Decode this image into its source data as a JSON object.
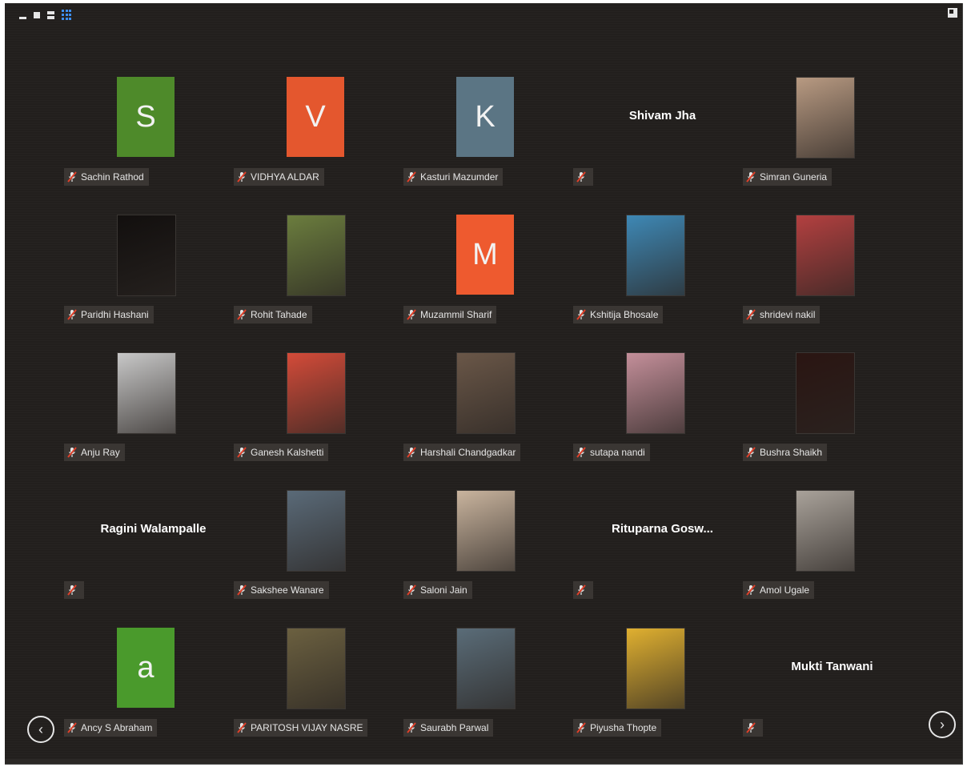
{
  "toolbar": {
    "icons": [
      "minimize-icon",
      "single-view-icon",
      "split-view-icon",
      "gallery-view-icon"
    ],
    "accent": "#3d8ef0"
  },
  "participants": [
    {
      "name": "Sachin Rathod",
      "avatar_letter": "S",
      "avatar_color": "#4e8a2a",
      "type": "letter"
    },
    {
      "name": "VIDHYA ALDAR",
      "avatar_letter": "V",
      "avatar_color": "#e4572e",
      "type": "letter"
    },
    {
      "name": "Kasturi Mazumder",
      "avatar_letter": "K",
      "avatar_color": "#5b7584",
      "type": "letter"
    },
    {
      "name": "",
      "display_name": "Shivam Jha",
      "type": "name"
    },
    {
      "name": "Simran Guneria",
      "type": "photo",
      "photo": "photo-woman-selfie",
      "tone": "#b89a82"
    },
    {
      "name": "Paridhi Hashani",
      "type": "photo",
      "photo": "photo-dark",
      "tone": "#120f0e"
    },
    {
      "name": "Rohit Tahade",
      "type": "photo",
      "photo": "photo-man-garden",
      "tone": "#6b7d3e"
    },
    {
      "name": "Muzammil Sharif",
      "avatar_letter": "M",
      "avatar_color": "#ee5a2f",
      "type": "letter"
    },
    {
      "name": "Kshitija Bhosale",
      "type": "photo",
      "photo": "photo-mountain-lake",
      "tone": "#3e88b5"
    },
    {
      "name": "shridevi nakil",
      "type": "photo",
      "photo": "photo-woman-red",
      "tone": "#b34040"
    },
    {
      "name": "Anju Ray",
      "type": "photo",
      "photo": "photo-man-suit",
      "tone": "#c8c8c8"
    },
    {
      "name": "Ganesh Kalshetti",
      "type": "photo",
      "photo": "photo-man-red-shirt",
      "tone": "#d44b39"
    },
    {
      "name": "Harshali Chandgadkar",
      "type": "photo",
      "photo": "photo-woman-portrait",
      "tone": "#6a5748"
    },
    {
      "name": "sutapa nandi",
      "type": "photo",
      "photo": "photo-woman-pink",
      "tone": "#c48f9a"
    },
    {
      "name": "Bushra Shaikh",
      "type": "photo",
      "photo": "photo-dark-red",
      "tone": "#2a1512"
    },
    {
      "name": "",
      "display_name": "Ragini Walampalle",
      "type": "name"
    },
    {
      "name": "Sakshee Wanare",
      "type": "photo",
      "photo": "photo-woman-selfie-2",
      "tone": "#5a6a78"
    },
    {
      "name": "Saloni Jain",
      "type": "photo",
      "photo": "photo-woman-light",
      "tone": "#c9b49e"
    },
    {
      "name": "",
      "display_name": "Rituparna  Gosw...",
      "type": "name"
    },
    {
      "name": "Amol Ugale",
      "type": "photo",
      "photo": "photo-man-standing",
      "tone": "#a9a29a"
    },
    {
      "name": "Ancy S Abraham",
      "avatar_letter": "a",
      "avatar_color": "#4a9a2c",
      "type": "letter"
    },
    {
      "name": "PARITOSH VIJAY NASRE",
      "type": "photo",
      "photo": "photo-marathali-badge",
      "tone": "#6b6040"
    },
    {
      "name": "Saurabh Parwal",
      "type": "photo",
      "photo": "photo-man-mirror-selfie",
      "tone": "#5a6c78"
    },
    {
      "name": "Piyusha Thopte",
      "type": "photo",
      "photo": "photo-man-sunglasses",
      "tone": "#e0b030"
    },
    {
      "name": "",
      "display_name": "Mukti Tanwani",
      "type": "name"
    }
  ],
  "navigation": {
    "prev": "‹",
    "next": "›"
  },
  "colors": {
    "background": "#221f1d",
    "name_tag": "#3a3633",
    "muted_icon": "#e0402a"
  }
}
